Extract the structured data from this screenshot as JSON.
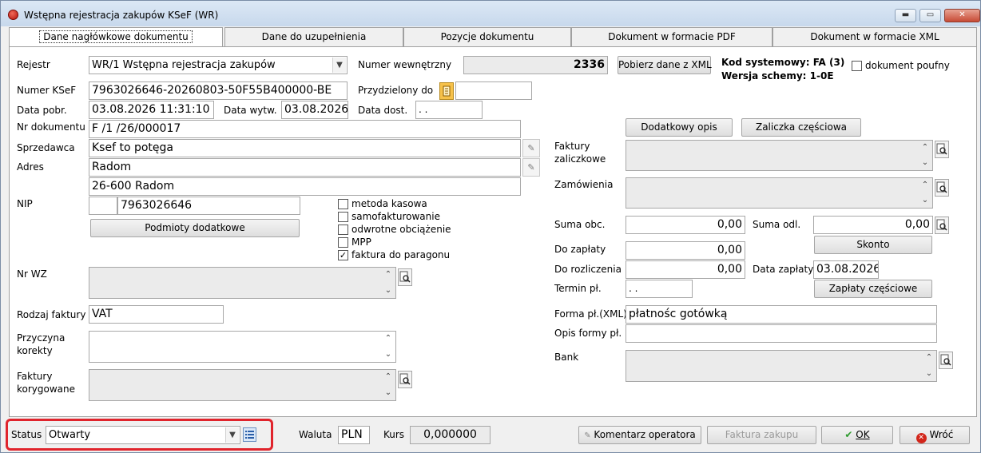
{
  "window": {
    "title": "Wstępna rejestracja zakupów KSeF (WR)",
    "minimize_label": "▬",
    "maximize_label": "▭",
    "close_label": "✕"
  },
  "tabs": [
    {
      "label": "Dane nagłówkowe dokumentu"
    },
    {
      "label": "Dane do uzupełnienia"
    },
    {
      "label": "Pozycje dokumentu"
    },
    {
      "label": "Dokument w formacie PDF"
    },
    {
      "label": "Dokument w formacie XML"
    }
  ],
  "left": {
    "rejestr_label": "Rejestr",
    "rejestr_value": "WR/1 Wstępna rejestracja zakupów",
    "numer_ksef_label": "Numer KSeF",
    "numer_ksef_value": "7963026646-20260803-50F55B400000-BE",
    "data_pobr_label": "Data pobr.",
    "data_pobr_value": "03.08.2026 11:31:10",
    "data_wytw_label": "Data wytw.",
    "data_wytw_value": "03.08.2026",
    "nr_dokumentu_label": "Nr dokumentu",
    "nr_dokumentu_value": "F /1  /26/000017",
    "sprzedawca_label": "Sprzedawca",
    "sprzedawca_value": "Ksef to potęga",
    "adres_label": "Adres",
    "adres_line1": "Radom",
    "adres_line2": "26-600 Radom",
    "nip_label": "NIP",
    "nip_prefix": "",
    "nip_value": "7963026646",
    "podmioty_button": "Podmioty dodatkowe",
    "nr_wz_label": "Nr WZ",
    "rodzaj_faktury_label": "Rodzaj faktury",
    "rodzaj_faktury_value": "VAT",
    "przyczyna_korekty_label_1": "Przyczyna",
    "przyczyna_korekty_label_2": "korekty",
    "faktury_korygowane_label_1": "Faktury",
    "faktury_korygowane_label_2": "korygowane"
  },
  "checkboxes": [
    {
      "label": "metoda kasowa",
      "checked": false
    },
    {
      "label": "samofakturowanie",
      "checked": false
    },
    {
      "label": "odwrotne obciążenie",
      "checked": false
    },
    {
      "label": "MPP",
      "checked": false
    },
    {
      "label": "faktura do paragonu",
      "checked": true
    }
  ],
  "middle": {
    "numer_wewnetrzny_label": "Numer wewnętrzny",
    "numer_wewnetrzny_value": "2336",
    "pobierz_button": "Pobierz dane z XML",
    "przydzielony_do_label": "Przydzielony do",
    "przydzielony_do_value": "",
    "data_dost_label": "Data dost.",
    "data_dost_value": " .  ."
  },
  "system": {
    "kod_systemowy": "Kod systemowy: FA (3)",
    "wersja_schemy": "Wersja schemy: 1-0E",
    "dokument_poufny_label": "dokument poufny"
  },
  "right": {
    "dodatkowy_opis_button": "Dodatkowy opis",
    "zaliczka_button": "Zaliczka częściowa",
    "faktury_zaliczkowe_label_1": "Faktury",
    "faktury_zaliczkowe_label_2": "zaliczkowe",
    "zamowienia_label": "Zamówienia",
    "suma_obc_label": "Suma obc.",
    "suma_obc_value": "0,00",
    "suma_odl_label": "Suma odl.",
    "suma_odl_value": "0,00",
    "skonto_button": "Skonto",
    "do_zaplaty_label": "Do zapłaty",
    "do_zaplaty_value": "0,00",
    "do_rozliczenia_label": "Do rozliczenia",
    "do_rozliczenia_value": "0,00",
    "data_zaplaty_label": "Data zapłaty",
    "data_zaplaty_value": "03.08.2026",
    "termin_pl_label": "Termin pł.",
    "termin_pl_value": " .  .",
    "zaplaty_czesciowe_button": "Zapłaty częściowe",
    "forma_pl_label": "Forma pł.(XML)",
    "forma_pl_value": "płatnośc gotówką",
    "opis_formy_label": "Opis formy pł.",
    "opis_formy_value": "",
    "bank_label": "Bank"
  },
  "bottom": {
    "status_label": "Status",
    "status_value": "Otwarty",
    "waluta_label": "Waluta",
    "waluta_value": "PLN",
    "kurs_label": "Kurs",
    "kurs_value": "0,000000",
    "komentarz_button": "Komentarz operatora",
    "faktura_zakupu_button": "Faktura zakupu",
    "ok_button": "OK",
    "wroc_button": "Wróć"
  },
  "colors": {
    "highlight_frame": "#e0242c",
    "ok_check": "#2e9b2e",
    "wroc_icon": "#d2261b"
  }
}
